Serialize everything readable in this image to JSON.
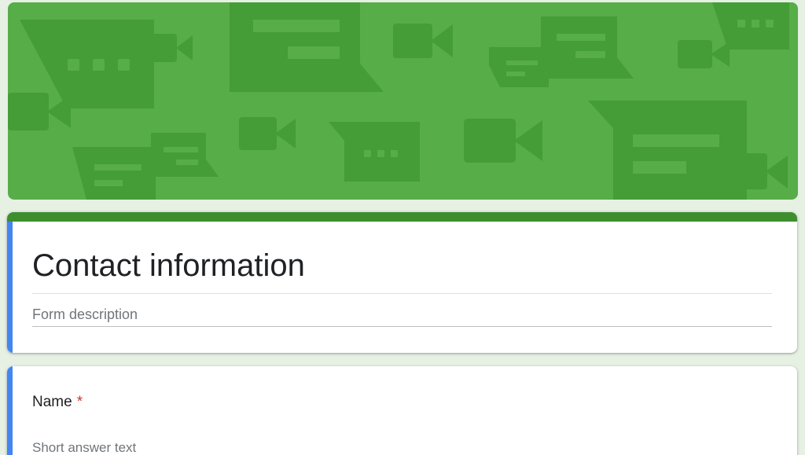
{
  "banner": {
    "theme_color": "#57ad48",
    "accent_color": "#3d8f2d",
    "pattern_icons": [
      "chat-bubble-icon",
      "video-camera-icon"
    ]
  },
  "form": {
    "title": "Contact information",
    "description_placeholder": "Form description",
    "header_accent_color": "#3d8f2d",
    "selected_stripe_color": "#4285f4"
  },
  "question": {
    "title": "Name",
    "required_mark": "*",
    "answer_placeholder": "Short answer text"
  }
}
